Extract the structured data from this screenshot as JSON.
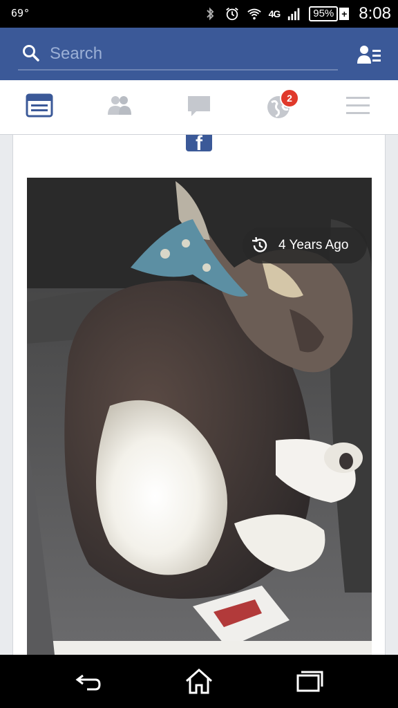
{
  "status_bar": {
    "temperature": "69°",
    "network": "4G",
    "battery": "95%",
    "battery_plus": "+",
    "time": "8:08",
    "icons": [
      "bluetooth-icon",
      "alarm-icon",
      "wifi-icon",
      "signal-icon",
      "battery-icon"
    ]
  },
  "topbar": {
    "search_placeholder": "Search",
    "search_value": "",
    "friends_icon": "friend-requests-icon",
    "brand_color": "#3b5998"
  },
  "nav": {
    "tabs": [
      {
        "name": "news-feed",
        "icon": "news-feed-icon",
        "active": true
      },
      {
        "name": "friends",
        "icon": "friends-icon",
        "active": false
      },
      {
        "name": "messages",
        "icon": "chat-icon",
        "active": false
      },
      {
        "name": "notifications",
        "icon": "globe-icon",
        "active": false,
        "badge": "2"
      },
      {
        "name": "more",
        "icon": "menu-icon",
        "active": false
      }
    ],
    "badge_color": "#e0392b"
  },
  "post": {
    "logo_text": "f",
    "memory_label": "4 Years Ago",
    "memory_icon": "history-icon",
    "photo_subject": "sleeping puppy in car seat"
  },
  "system_nav": {
    "buttons": [
      "back-icon",
      "home-icon",
      "recent-apps-icon"
    ]
  }
}
